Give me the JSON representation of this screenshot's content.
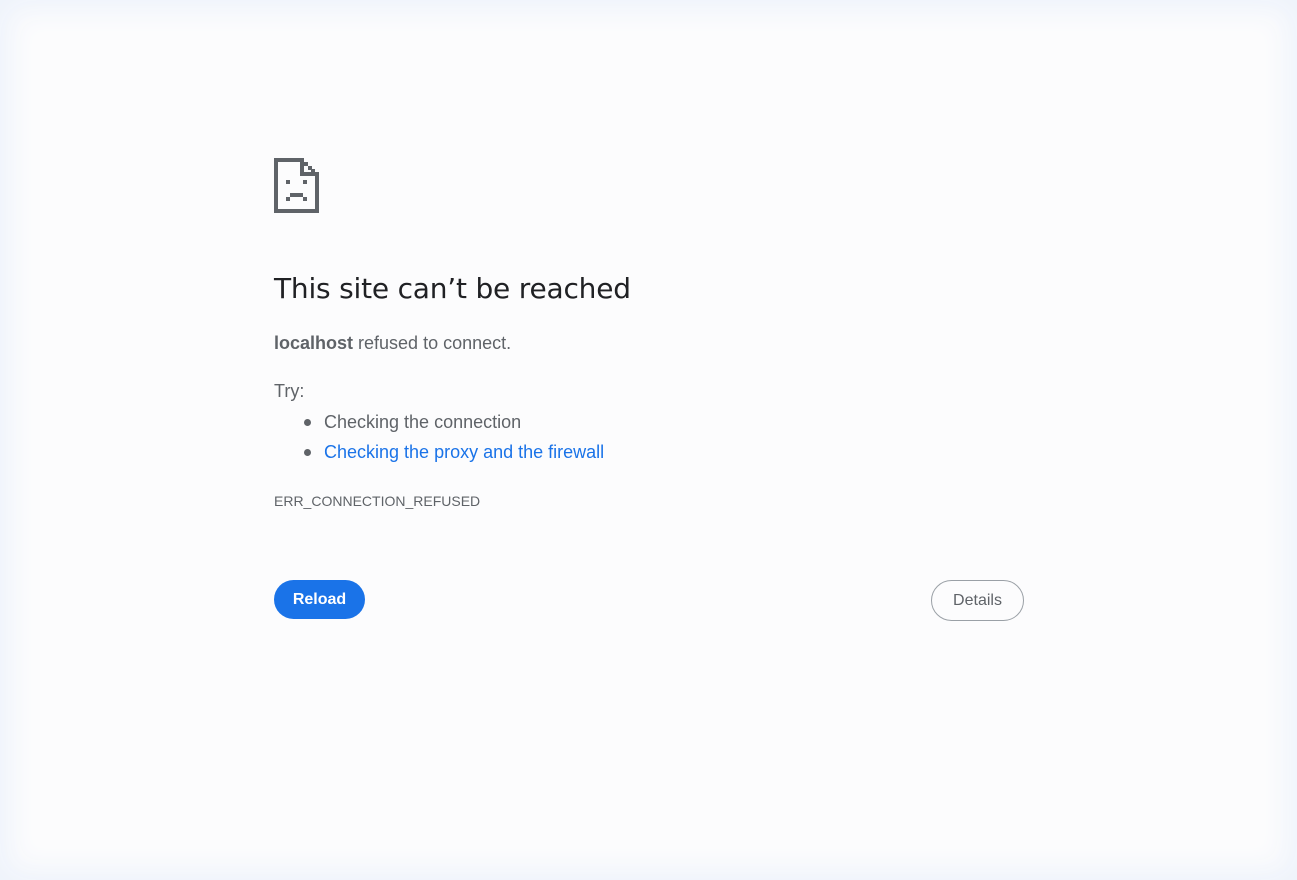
{
  "page": {
    "icon": "sad-page-icon",
    "title": "This site can’t be reached",
    "summary": {
      "host": "localhost",
      "message": "refused to connect."
    },
    "try_label": "Try:",
    "suggestions": [
      {
        "label": "Checking the connection",
        "is_link": false
      },
      {
        "label": "Checking the proxy and the firewall",
        "is_link": true
      }
    ],
    "error_code": "ERR_CONNECTION_REFUSED",
    "buttons": {
      "reload": "Reload",
      "details": "Details"
    }
  },
  "colors": {
    "background": "#fcfcfd",
    "title": "#202124",
    "body_text": "#5f6368",
    "link": "#1a73e8",
    "primary_button": "#1a73e8",
    "primary_button_text": "#ffffff",
    "secondary_button_border": "#9aa0a6"
  }
}
